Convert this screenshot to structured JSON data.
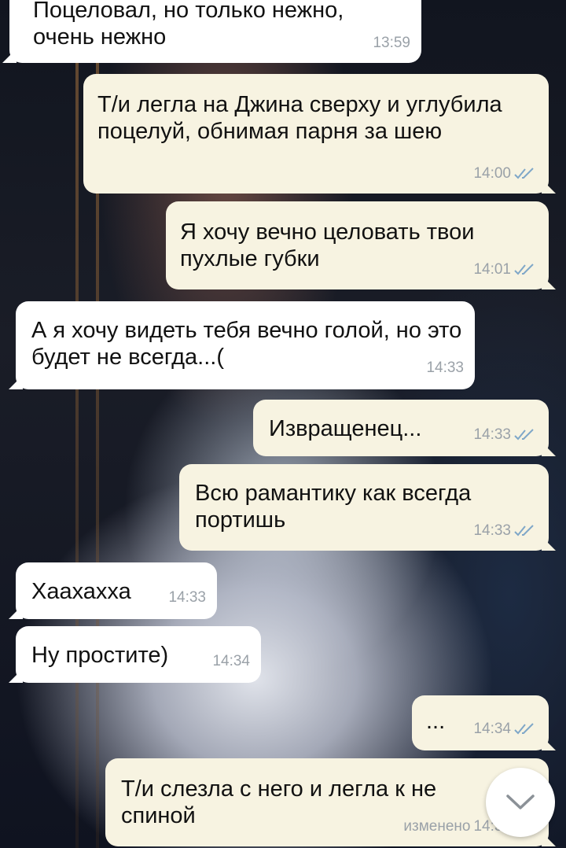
{
  "messages": [
    {
      "direction": "in",
      "text": "Поцеловал, но только нежно, очень нежно",
      "time": "13:59"
    },
    {
      "direction": "out",
      "text": "Т/и легла на Джина сверху и углубила поцелуй, обнимая парня за шею",
      "time": "14:00",
      "status": "read"
    },
    {
      "direction": "out",
      "text": "Я хочу вечно целовать твои пухлые губки",
      "time": "14:01",
      "status": "read"
    },
    {
      "direction": "in",
      "text": "А я хочу видеть тебя вечно голой, но это будет не всегда...(",
      "time": "14:33"
    },
    {
      "direction": "out",
      "text": "Извращенец...",
      "time": "14:33",
      "status": "read"
    },
    {
      "direction": "out",
      "text": "Всю рамантику как всегда портишь",
      "time": "14:33",
      "status": "read"
    },
    {
      "direction": "in",
      "text": "Хаахахха",
      "time": "14:33"
    },
    {
      "direction": "in",
      "text": "Ну простите)",
      "time": "14:34"
    },
    {
      "direction": "out",
      "text": "...",
      "time": "14:34",
      "status": "read"
    },
    {
      "direction": "out",
      "text": "Т/и слезла с него и легла к не спиной",
      "time": "14:34",
      "edited_label": "изменено",
      "status": "read"
    }
  ],
  "scroll_button": {
    "icon": "chevron-down-icon"
  },
  "colors": {
    "incoming_bubble": "#ffffff",
    "outgoing_bubble": "#f7f3e1",
    "meta_text": "#9aa1a8",
    "read_ticks": "#7fa7c8"
  }
}
